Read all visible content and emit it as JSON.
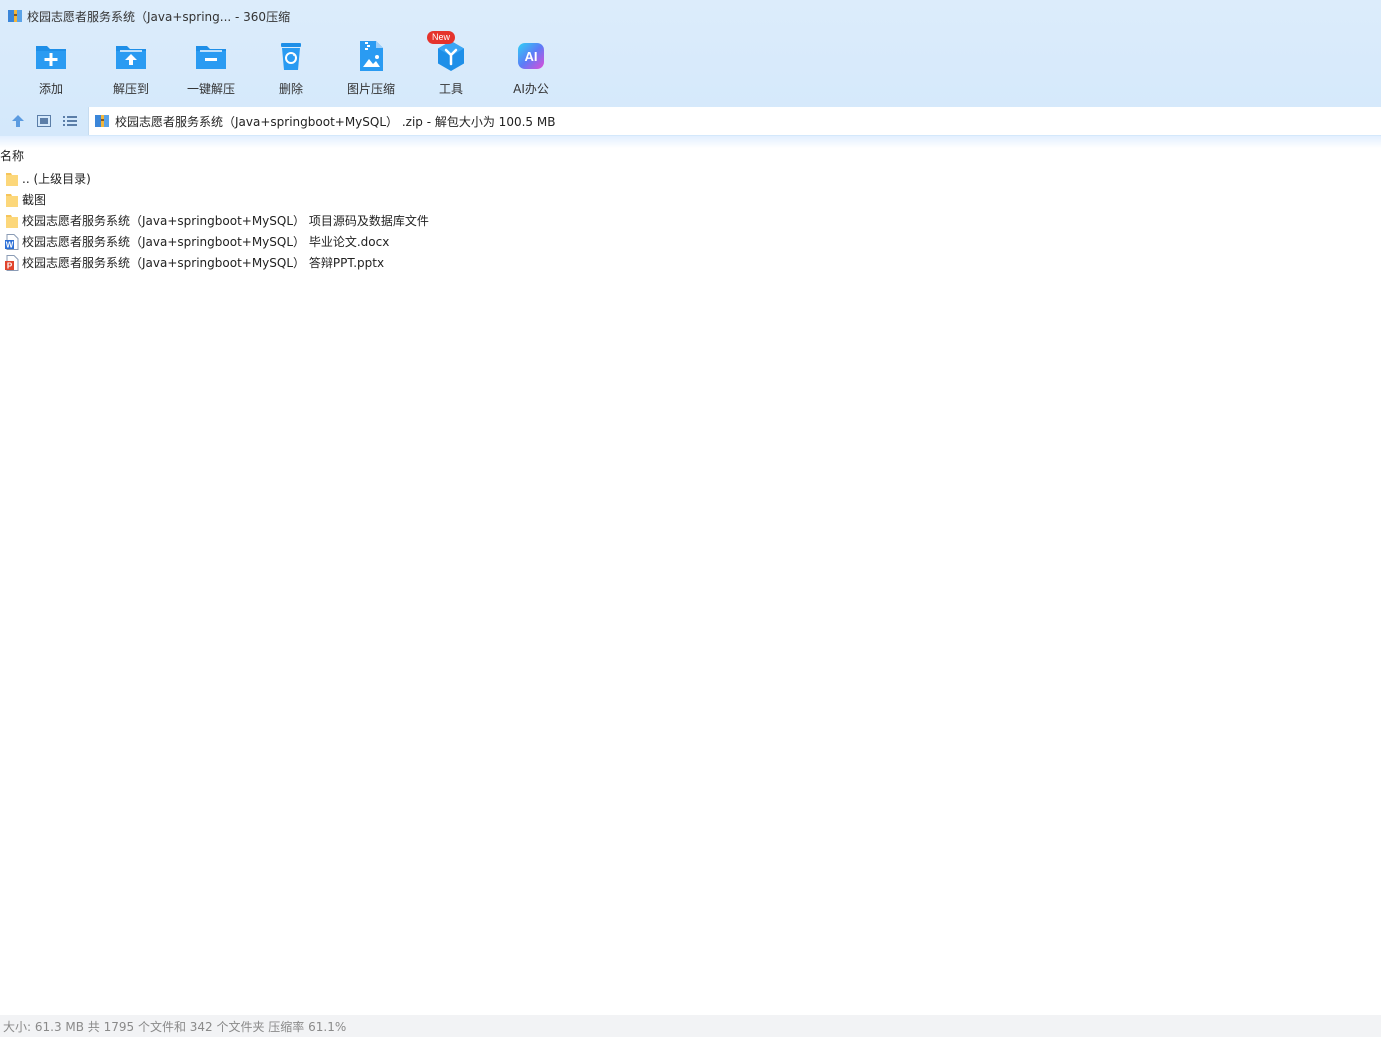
{
  "window": {
    "title": "校园志愿者服务系统（Java+spring... - 360压缩"
  },
  "toolbar": {
    "items": [
      {
        "label": "添加",
        "icon": "add-folder-icon"
      },
      {
        "label": "解压到",
        "icon": "extract-to-icon"
      },
      {
        "label": "一键解压",
        "icon": "one-click-extract-icon"
      },
      {
        "label": "删除",
        "icon": "recycle-bin-icon"
      },
      {
        "label": "图片压缩",
        "icon": "image-compress-icon"
      },
      {
        "label": "工具",
        "icon": "tools-icon",
        "badge": "New"
      },
      {
        "label": "AI办公",
        "icon": "ai-office-icon",
        "icon_text": "AI"
      }
    ]
  },
  "address": {
    "path": "校园志愿者服务系统（Java+springboot+MySQL） .zip - 解包大小为 100.5 MB"
  },
  "list": {
    "column_name": "名称",
    "rows": [
      {
        "name": ".. (上级目录)",
        "type": "folder"
      },
      {
        "name": "截图",
        "type": "folder"
      },
      {
        "name": "校园志愿者服务系统（Java+springboot+MySQL） 项目源码及数据库文件",
        "type": "folder"
      },
      {
        "name": "校园志愿者服务系统（Java+springboot+MySQL） 毕业论文.docx",
        "type": "word",
        "icon_text": "W"
      },
      {
        "name": "校园志愿者服务系统（Java+springboot+MySQL） 答辩PPT.pptx",
        "type": "ppt",
        "icon_text": "P"
      }
    ]
  },
  "status": {
    "text": "大小: 61.3 MB 共 1795 个文件和 342 个文件夹 压缩率 61.1%"
  },
  "colors": {
    "accent": "#1e8fe8",
    "badge": "#e5332c",
    "folder": "#fcd77a",
    "word": "#2b6fd6",
    "ppt": "#e0442d"
  }
}
